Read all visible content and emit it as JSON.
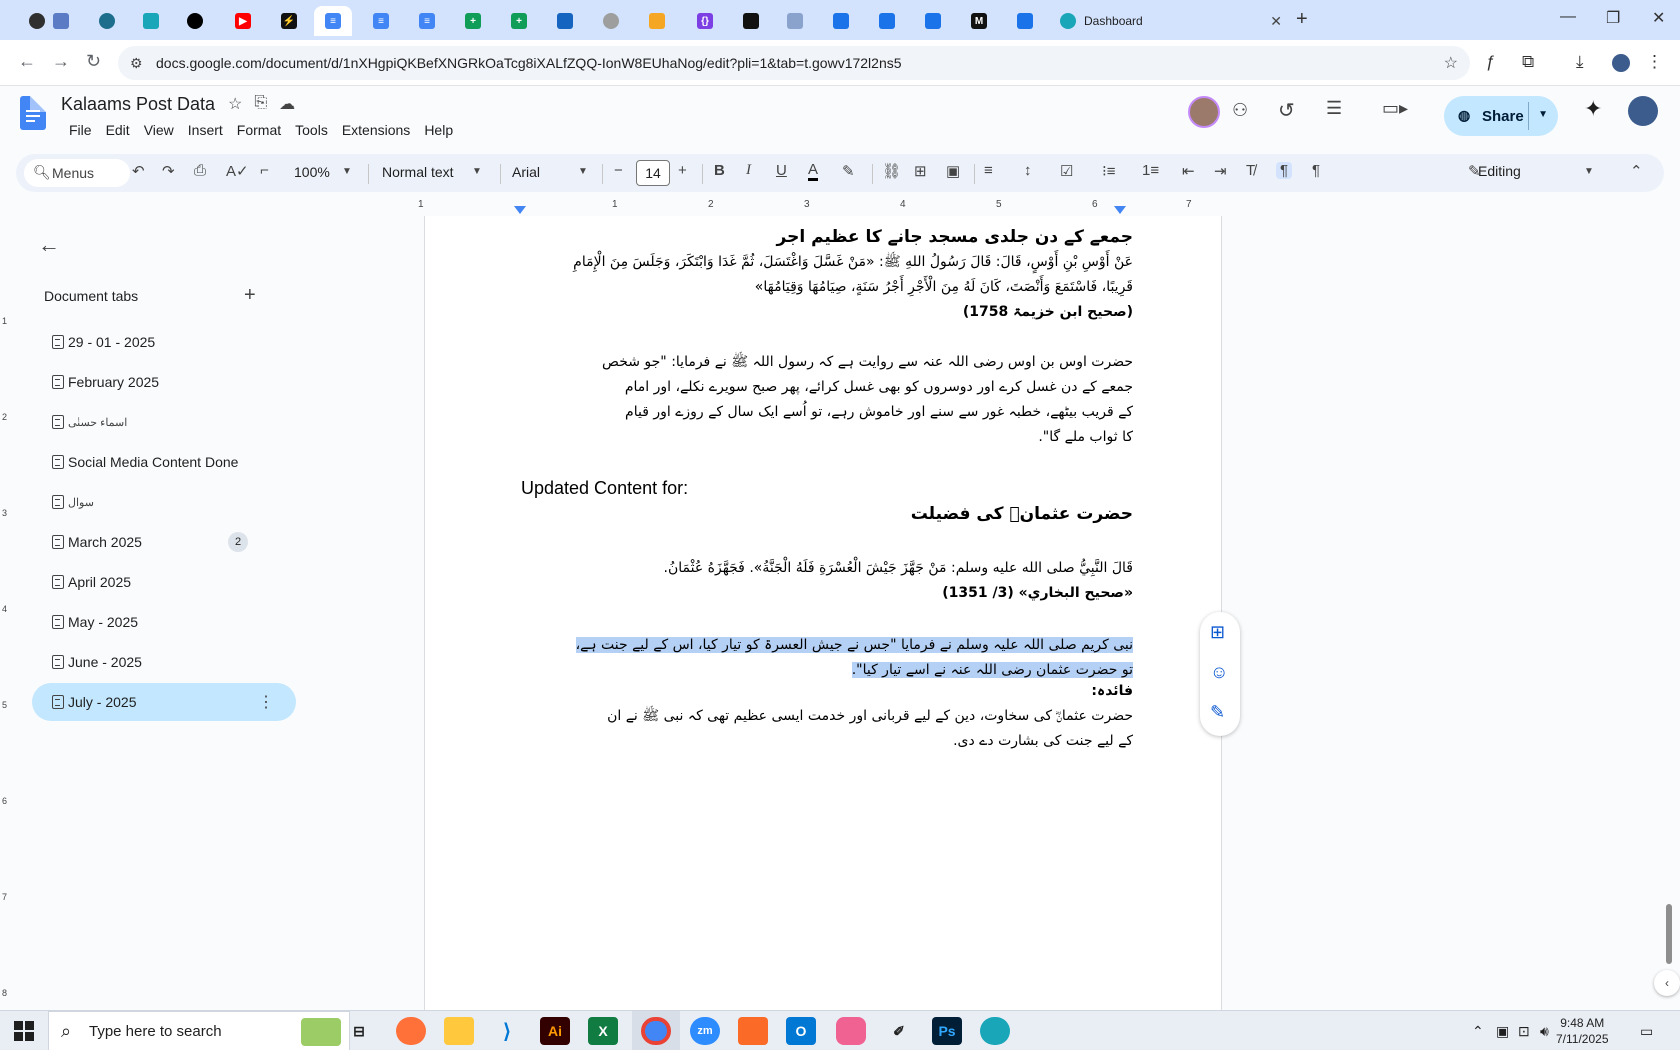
{
  "browser": {
    "active_tab_title": "Dashboard",
    "url": "docs.google.com/document/d/1nXHgpiQKBefXNGRkOaTcg8iXALfZQQ-IonW8EUhaNog/edit?pli=1&tab=t.gowv172l2ns5"
  },
  "docs": {
    "title": "Kalaams Post Data",
    "menu": [
      "File",
      "Edit",
      "View",
      "Insert",
      "Format",
      "Tools",
      "Extensions",
      "Help"
    ],
    "share_label": "Share",
    "toolbar": {
      "menus_label": "Menus",
      "zoom": "100%",
      "style": "Normal text",
      "font": "Arial",
      "font_size": "14",
      "mode": "Editing"
    },
    "ruler_numbers": [
      "1",
      "1",
      "2",
      "3",
      "4",
      "5",
      "6",
      "7"
    ],
    "vruler_numbers": [
      "1",
      "2",
      "3",
      "4",
      "5",
      "6",
      "7",
      "8"
    ]
  },
  "sidebar": {
    "title": "Document tabs",
    "items": [
      {
        "label": "29 - 01 - 2025"
      },
      {
        "label": "February 2025"
      },
      {
        "label": "اسماء حسنٰی"
      },
      {
        "label": "Social Media Content Done"
      },
      {
        "label": "سوال"
      },
      {
        "label": "March 2025",
        "badge": "2"
      },
      {
        "label": "April 2025"
      },
      {
        "label": "May - 2025"
      },
      {
        "label": "June - 2025"
      },
      {
        "label": "July - 2025"
      }
    ]
  },
  "document": {
    "heading1": "جمعے کے دن جلدی مسجد جانے کا عظیم اجر",
    "hadith1_line1": "عَنْ أَوْسِ بْنِ أَوْسٍ، قَالَ: قَالَ رَسُولُ اللهِ ﷺ: «مَنْ غَسَّلَ وَاغْتَسَلَ، ثُمَّ غَدَا وَابْتَكَرَ، وَجَلَسَ مِنَ الْإِمَامِ",
    "hadith1_line2": "قَرِيبًا، فَاسْتَمَعَ وَأَنْصَتَ، كَانَ لَهُ مِنَ الْأَجْرِ أَجْرُ سَنَةٍ، صِيَامُهَا وَقِيَامُهَا»",
    "ref1": "(صحیح ابن خزیمۃ 1758)",
    "urdu1_line1": "حضرت اوس بن اوس رضی اللہ عنہ سے روایت ہے کہ رسول اللہ ﷺ نے فرمایا: \"جو شخص",
    "urdu1_line2": "جمعے کے دن غسل کرے اور دوسروں کو بھی غسل کرائے، پھر صبح سویرے نکلے، اور امام",
    "urdu1_line3": "کے قریب بیٹھے، خطبہ غور سے سنے اور خاموش رہے، تو اُسے ایک سال کے روزے اور قیام",
    "urdu1_line4": "کا ثواب ملے گا\".",
    "updated_label": "Updated Content for:",
    "heading2": "حضرت عثمانؓ کی فضیلت",
    "hadith2": "قَالَ النَّبِيُّ صلى الله عليه وسلم: مَنْ جَهَّزَ جَيْشَ الْعُسْرَةِ فَلَهُ الْجَنَّةُ». فَجَهَّزَهُ عُثْمَانُ.",
    "ref2": "«صحيح البخاري» (3/ 1351)",
    "urdu2_line1": "نبی کریم صلی اللہ علیہ وسلم نے فرمایا \"جس نے جیش العسرۃ کو تیار کیا، اس کے لیے جنت ہے،",
    "urdu2_line2": "تو حضرت عثمان رضی اللہ عنہ نے اسے تیار کیا\".",
    "faida_label": "فائدہ:",
    "urdu3_line1": "حضرت عثمانؓ کی سخاوت، دین کے لیے قربانی اور خدمت ایسی عظیم تھی کہ نبی ﷺ نے ان",
    "urdu3_line2": "کے لیے جنت کی بشارت دے دی."
  },
  "taskbar": {
    "search_placeholder": "Type here to search",
    "time": "9:48 AM",
    "date": "7/11/2025"
  }
}
